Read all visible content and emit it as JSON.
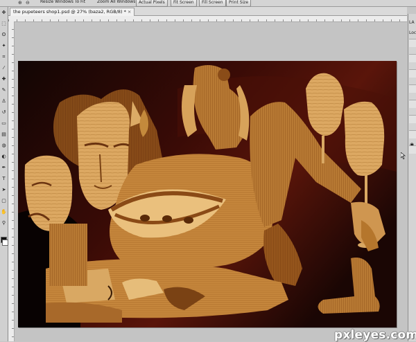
{
  "options_bar": {
    "resize_windows_label": "Resize Windows To Fit",
    "zoom_all_windows_label": "Zoom All Windows",
    "actual_pixels_label": "Actual Pixels",
    "fit_screen_label": "Fit Screen",
    "fill_screen_label": "Fill Screen",
    "print_size_label": "Print Size"
  },
  "document": {
    "tab_title": "the pupeteers shop1.psd @ 27% (baza2, RGB/8) *",
    "close_glyph": "×"
  },
  "layers_panel": {
    "title": "LA",
    "lock_label": "Loc"
  },
  "watermark": {
    "text": "pxleyes.com"
  },
  "icons": {
    "zoom": "zoom-icon",
    "eye": "eye-icon"
  },
  "colors": {
    "ui_gray": "#c6c6c6",
    "canvas_dark": "#0c0403",
    "wood_light": "#d8a45a",
    "wood_mid": "#b9782f",
    "wood_dark": "#7a4514"
  }
}
